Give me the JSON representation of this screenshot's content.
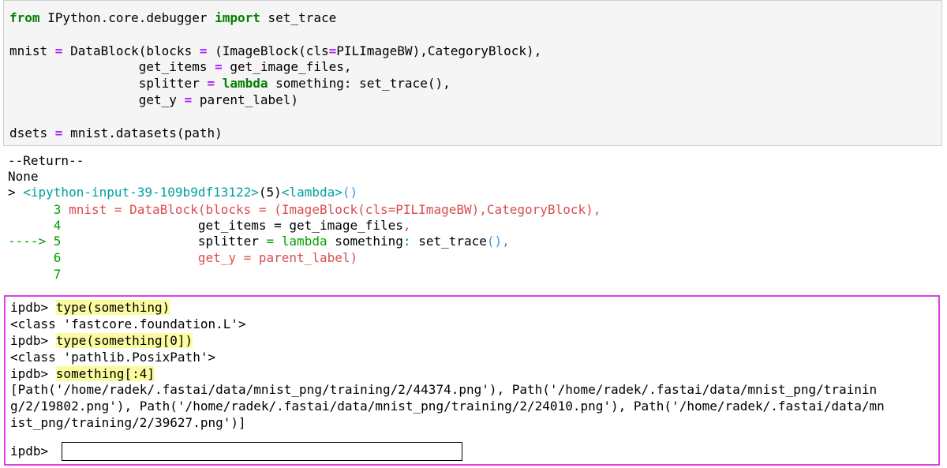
{
  "code_cell": {
    "line1_kw1": "from",
    "line1_mid": " IPython.core.debugger ",
    "line1_kw2": "import",
    "line1_end": " set_trace",
    "line3_a": "mnist ",
    "line3_eq": "=",
    "line3_b": " DataBlock(blocks ",
    "line3_eq2": "=",
    "line3_c": " (ImageBlock(cls",
    "line3_eq3": "=",
    "line3_d": "PILImageBW),CategoryBlock),",
    "line4_a": "                 get_items ",
    "line4_eq": "=",
    "line4_b": " get_image_files,",
    "line5_a": "                 splitter ",
    "line5_eq": "=",
    "line5_kw": "lambda",
    "line5_b": " something: set_trace(),",
    "line6_a": "                 get_y ",
    "line6_eq": "=",
    "line6_b": " parent_label)",
    "line8_a": "dsets ",
    "line8_eq": "=",
    "line8_b": " mnist.datasets(path)"
  },
  "trace": {
    "return": "--Return--",
    "none": "None",
    "loc_prefix": "> ",
    "loc_file": "<ipython-input-39-109b9df13122>",
    "loc_line": "(5)",
    "loc_func": "<lambda>",
    "loc_paren": "()",
    "l3_num": "      3 ",
    "l3_code": "mnist = DataBlock(blocks = (ImageBlock(cls=PILImageBW),CategoryBlock),",
    "l4_num": "      4 ",
    "l4_code": "                 get_items = get_image_files",
    "l4_comma": ",",
    "l5_arrow": "----> 5 ",
    "l5_a": "                 splitter ",
    "l5_eq": "=",
    "l5_kw": " lambda",
    "l5_b": " something",
    "l5_colon": ":",
    "l5_c": " set_trace",
    "l5_paren": "(),",
    "l6_num": "      6 ",
    "l6_code": "                 get_y = parent_label)",
    "l7_num": "      7"
  },
  "pdb": {
    "prompt": "ipdb> ",
    "cmd1": "type(something)",
    "out1": "<class 'fastcore.foundation.L'>",
    "cmd2": "type(something[0])",
    "out2": "<class 'pathlib.PosixPath'>",
    "cmd3": "something[:4]",
    "out3_l1": "[Path('/home/radek/.fastai/data/mnist_png/training/2/44374.png'), Path('/home/radek/.fastai/data/mnist_png/trainin",
    "out3_l2": "g/2/19802.png'), Path('/home/radek/.fastai/data/mnist_png/training/2/24010.png'), Path('/home/radek/.fastai/data/mn",
    "out3_l3": "ist_png/training/2/39627.png')]",
    "input_prompt": "ipdb> ",
    "input_value": ""
  }
}
